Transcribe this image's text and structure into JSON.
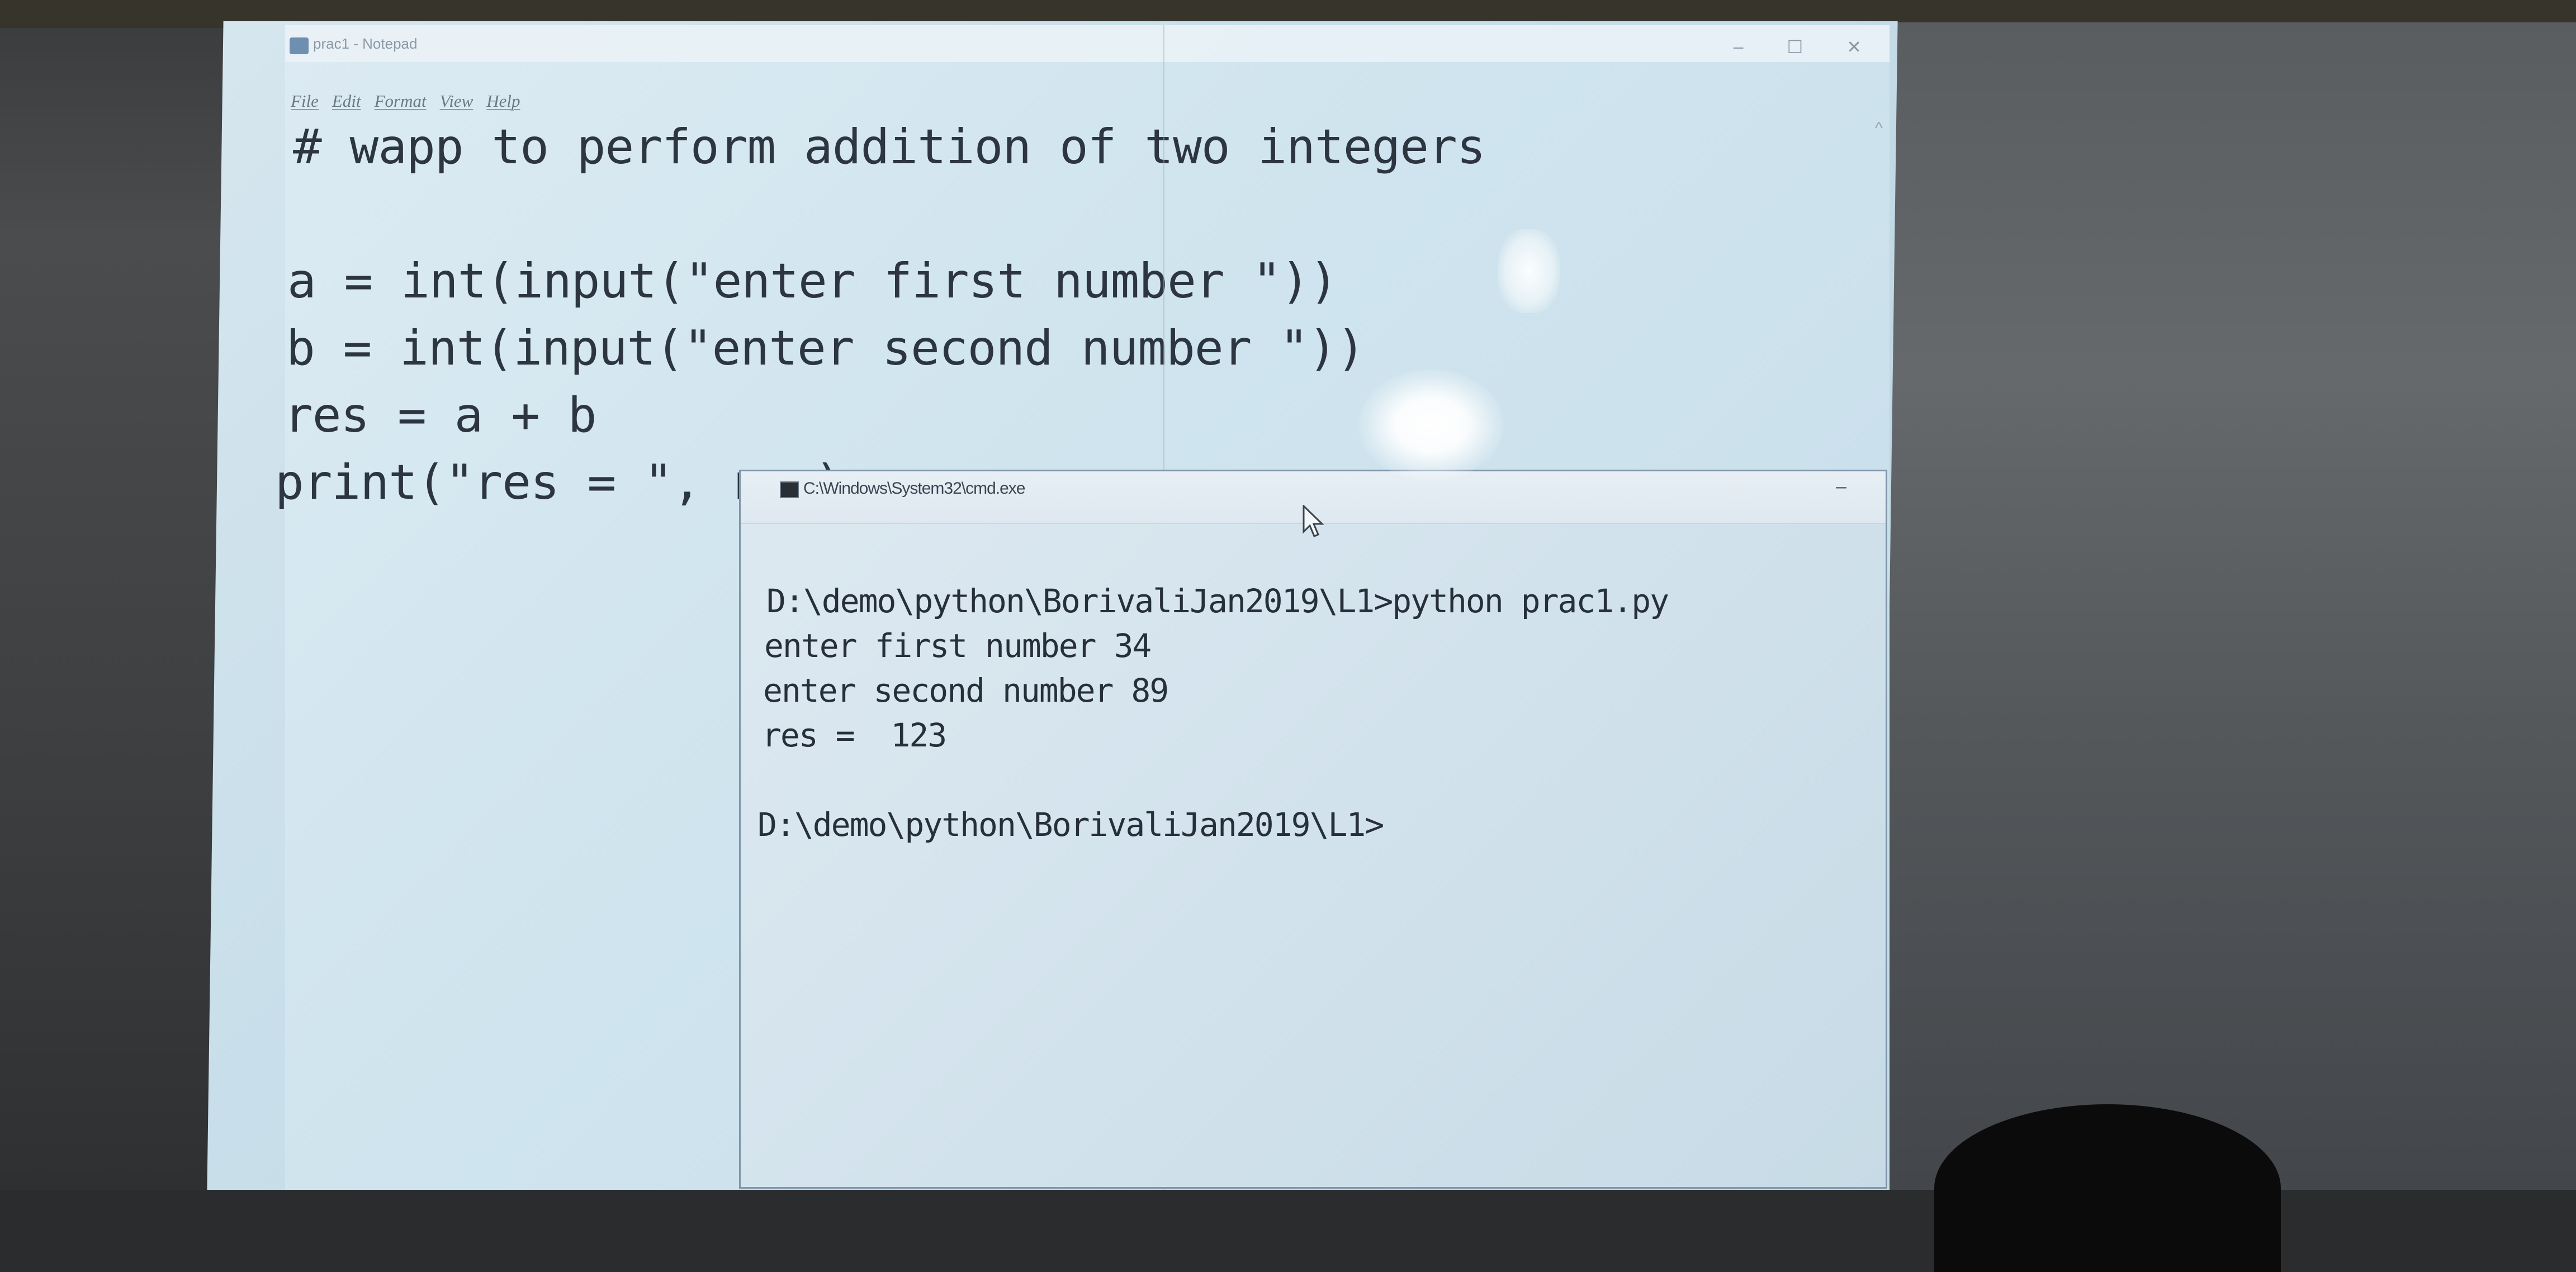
{
  "notepad": {
    "title": "prac1 - Notepad",
    "menu": [
      "File",
      "Edit",
      "Format",
      "View",
      "Help"
    ],
    "window_controls": [
      "–",
      "☐",
      "✕"
    ],
    "code_lines": [
      "# wapp to perform addition of two integers",
      "",
      "a = int(input(\"enter first number \"))",
      "b = int(input(\"enter second number \"))",
      "res = a + b",
      "print(\"res = \", res)"
    ]
  },
  "cmd": {
    "title": "C:\\Windows\\System32\\cmd.exe",
    "minimize": "–",
    "lines": [
      "D:\\demo\\python\\BorivaliJan2019\\L1>python prac1.py",
      "enter first number 34",
      "enter second number 89",
      "res =  123",
      "",
      "D:\\demo\\python\\BorivaliJan2019\\L1>"
    ]
  },
  "colors": {
    "screen": "#cfe4ee",
    "text": "#2c3540",
    "room": "#3e4042"
  },
  "icons": {
    "notepad_app": "notepad-icon",
    "cmd_app": "cmd-icon",
    "pointer": "mouse-cursor-icon"
  }
}
